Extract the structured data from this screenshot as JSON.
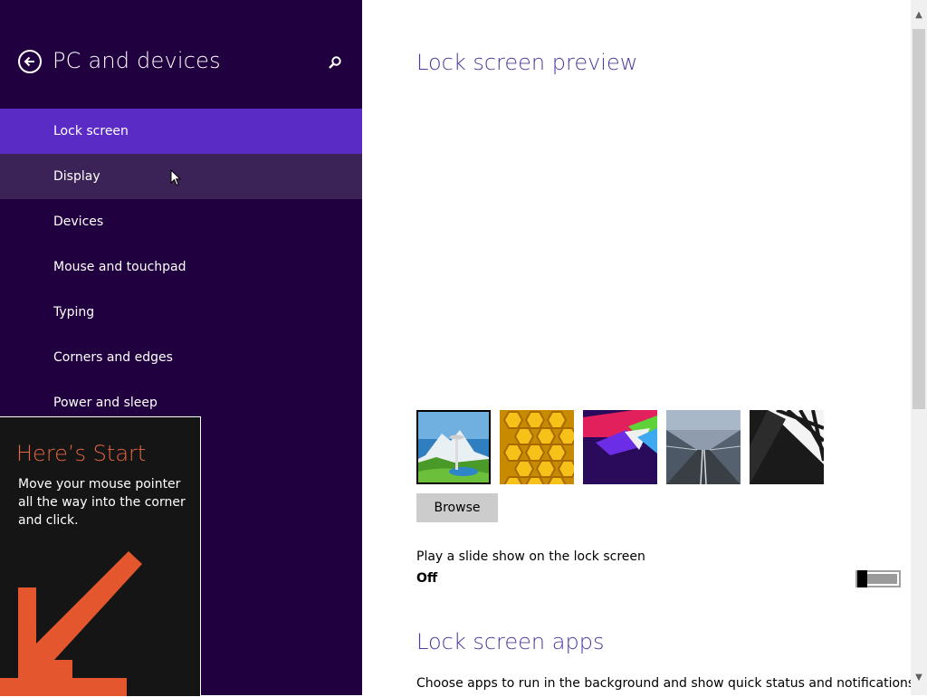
{
  "sidebar": {
    "title": "PC and devices",
    "items": [
      {
        "label": "Lock screen",
        "state": "selected"
      },
      {
        "label": "Display",
        "state": "hover"
      },
      {
        "label": "Devices",
        "state": ""
      },
      {
        "label": "Mouse and touchpad",
        "state": ""
      },
      {
        "label": "Typing",
        "state": ""
      },
      {
        "label": "Corners and edges",
        "state": ""
      },
      {
        "label": "Power and sleep",
        "state": ""
      }
    ]
  },
  "tip": {
    "title": "Here’s Start",
    "body": "Move your mouse pointer all the way into the corner and click."
  },
  "main": {
    "preview_heading": "Lock screen preview",
    "browse_label": "Browse",
    "slideshow_label": "Play a slide show on the lock screen",
    "slideshow_state": "Off",
    "apps_heading": "Lock screen apps",
    "apps_description": "Choose apps to run in the background and show quick status and notifications,"
  },
  "colors": {
    "sidebar_bg": "#21003f",
    "selected_bg": "#5b2bc5",
    "accent_heading": "#4e3a9e",
    "tip_title": "#e66542"
  },
  "icons": [
    "back-arrow-icon",
    "search-icon",
    "mouse-cursor-icon",
    "corner-arrow-icon",
    "chevron-up-icon",
    "chevron-down-icon"
  ]
}
